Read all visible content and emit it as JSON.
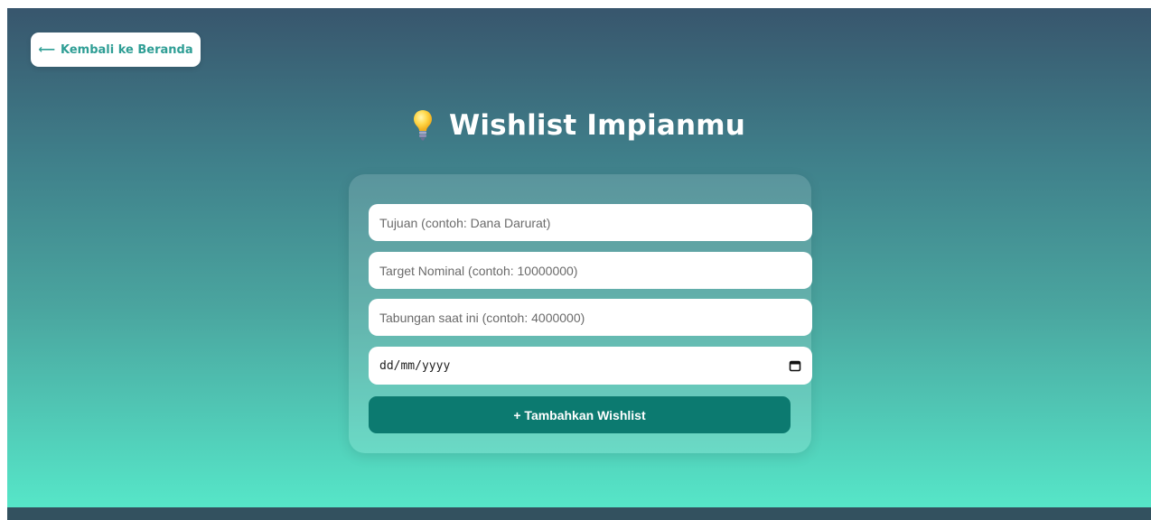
{
  "nav": {
    "back_label": "Kembali ke Beranda",
    "back_arrow": "⟵"
  },
  "header": {
    "title": "Wishlist Impianmu",
    "icon": "lightbulb-icon"
  },
  "form": {
    "goal_placeholder": "Tujuan (contoh: Dana Darurat)",
    "goal_value": "",
    "target_placeholder": "Target Nominal (contoh: 10000000)",
    "target_value": "",
    "savings_placeholder": "Tabungan saat ini (contoh: 4000000)",
    "savings_value": "",
    "date_display": "dd/mm/yyyy",
    "date_icon": "calendar-icon",
    "submit_label": "+ Tambahkan Wishlist"
  },
  "colors": {
    "gradient_top": "#38566d",
    "gradient_bottom": "#56e6c8",
    "accent": "#2f9e95",
    "button": "#0c7a70",
    "footer": "#33515f"
  }
}
